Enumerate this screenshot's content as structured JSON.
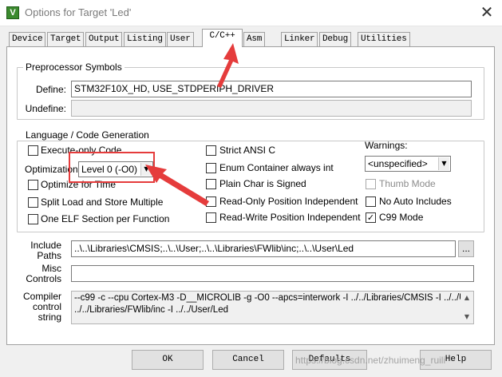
{
  "window": {
    "title": "Options for Target 'Led'",
    "app_icon": "keil-uvision-icon",
    "close_symbol": "✕"
  },
  "tabs": [
    {
      "label": "Device",
      "active": false
    },
    {
      "label": "Target",
      "active": false
    },
    {
      "label": "Output",
      "active": false
    },
    {
      "label": "Listing",
      "active": false
    },
    {
      "label": "User",
      "active": false
    },
    {
      "label": "C/C++",
      "active": true
    },
    {
      "label": "Asm",
      "active": false
    },
    {
      "label": "Linker",
      "active": false
    },
    {
      "label": "Debug",
      "active": false
    },
    {
      "label": "Utilities",
      "active": false
    }
  ],
  "preprocessor": {
    "group_label": "Preprocessor Symbols",
    "define_label": "Define:",
    "define_value": "STM32F10X_HD, USE_STDPERIPH_DRIVER",
    "undefine_label": "Undefine:",
    "undefine_value": ""
  },
  "language": {
    "group_label": "Language / Code Generation",
    "left_checks": [
      {
        "label": "Execute-only Code",
        "checked": false
      },
      {
        "label": "Optimize for Time",
        "checked": false
      },
      {
        "label": "Split Load and Store Multiple",
        "checked": false
      },
      {
        "label": "One ELF Section per Function",
        "checked": false
      }
    ],
    "optimization_label": "Optimization:",
    "optimization_value": "Level 0 (-O0)",
    "mid_checks": [
      {
        "label": "Strict ANSI C",
        "checked": false
      },
      {
        "label": "Enum Container always int",
        "checked": false
      },
      {
        "label": "Plain Char is Signed",
        "checked": false
      },
      {
        "label": "Read-Only Position Independent",
        "checked": false
      },
      {
        "label": "Read-Write Position Independent",
        "checked": false
      }
    ],
    "warnings_label": "Warnings:",
    "warnings_value": "<unspecified>",
    "right_checks": [
      {
        "label": "Thumb Mode",
        "checked": false,
        "disabled": true
      },
      {
        "label": "No Auto Includes",
        "checked": false,
        "disabled": false
      },
      {
        "label": "C99 Mode",
        "checked": true,
        "disabled": false
      }
    ]
  },
  "include_paths": {
    "label_line1": "Include",
    "label_line2": "Paths",
    "value": "..\\..\\Libraries\\CMSIS;..\\..\\User;..\\..\\Libraries\\FWlib\\inc;..\\..\\User\\Led",
    "browse_label": "..."
  },
  "misc_controls": {
    "label_line1": "Misc",
    "label_line2": "Controls",
    "value": ""
  },
  "compiler_string": {
    "label_line1": "Compiler",
    "label_line2": "control",
    "label_line3": "string",
    "line1": "--c99 -c --cpu Cortex-M3 -D__MICROLIB -g -O0 --apcs=interwork -I ../../Libraries/CMSIS -I ../../User -I",
    "line2": "../../Libraries/FWlib/inc -I ../../User/Led"
  },
  "buttons": {
    "ok": "OK",
    "cancel": "Cancel",
    "defaults": "Defaults",
    "help": "Help"
  },
  "watermark": "https://blog.csdn.net/zhuimeng_ruili",
  "colors": {
    "annotation": "#e53c3c",
    "panel_bg": "#ffffff",
    "dialog_bg": "#f0f0f0"
  }
}
